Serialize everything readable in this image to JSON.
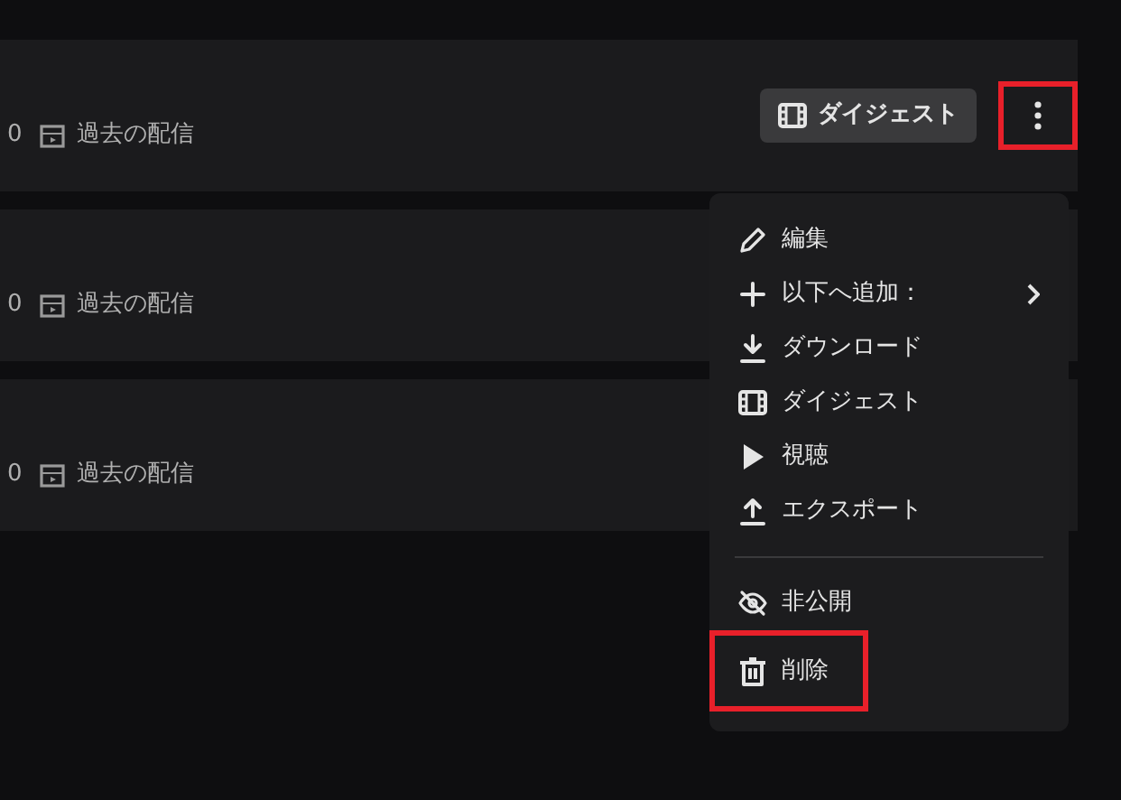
{
  "rows": [
    {
      "count": "0",
      "status": "過去の配信",
      "digest_button": "ダイジェスト",
      "more_highlighted": true
    },
    {
      "count": "0",
      "status": "過去の配信"
    },
    {
      "count": "0",
      "status": "過去の配信"
    }
  ],
  "menu": {
    "items": [
      {
        "kind": "pencil",
        "label": "編集",
        "submenu": false,
        "highlighted": false
      },
      {
        "kind": "plus",
        "label": "以下へ追加：",
        "submenu": true,
        "highlighted": false
      },
      {
        "kind": "download",
        "label": "ダウンロード",
        "submenu": false,
        "highlighted": false
      },
      {
        "kind": "film",
        "label": "ダイジェスト",
        "submenu": false,
        "highlighted": false
      },
      {
        "kind": "play",
        "label": "視聴",
        "submenu": false,
        "highlighted": false
      },
      {
        "kind": "upload",
        "label": "エクスポート",
        "submenu": false,
        "highlighted": false
      },
      {
        "kind": "divider"
      },
      {
        "kind": "eye-off",
        "label": "非公開",
        "submenu": false,
        "highlighted": false
      },
      {
        "kind": "trash",
        "label": "削除",
        "submenu": false,
        "highlighted": true
      }
    ]
  }
}
